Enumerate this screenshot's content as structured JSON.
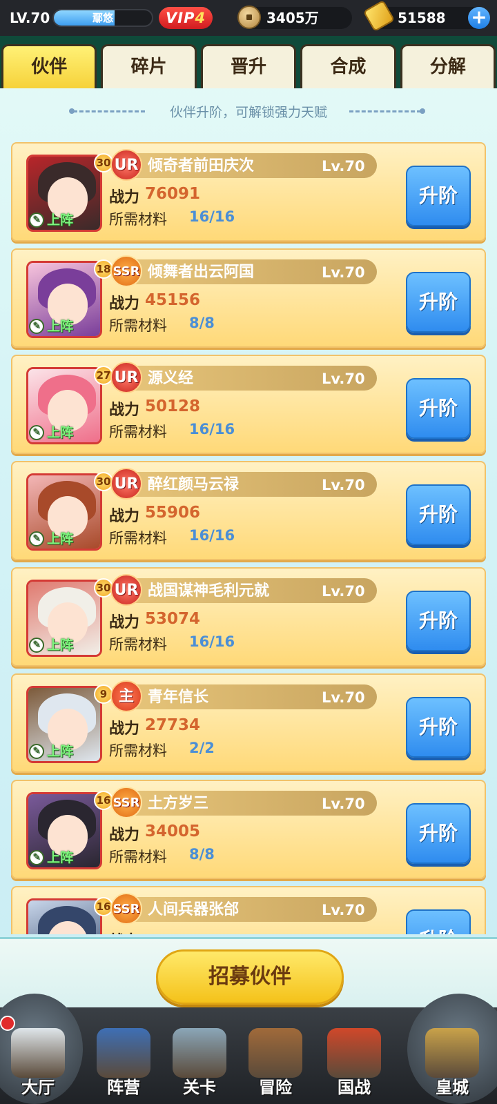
{
  "status": {
    "level": "LV.70",
    "player_name": "鄢悠",
    "exp_progress": 0.62,
    "vip_prefix": "VIP",
    "vip_level": "4",
    "coins": "3405万",
    "gold": "51588",
    "plus": "+"
  },
  "tabs": [
    {
      "label": "伙伴",
      "active": true
    },
    {
      "label": "碎片",
      "active": false
    },
    {
      "label": "晋升",
      "active": false
    },
    {
      "label": "合成",
      "active": false
    },
    {
      "label": "分解",
      "active": false
    }
  ],
  "hint": "伙伴升阶，可解锁强力天赋",
  "labels": {
    "power": "战力",
    "materials": "所需材料",
    "deploy": "上阵",
    "upgrade": "升阶"
  },
  "partners": [
    {
      "rarity": "UR",
      "name": "倾奇者前田庆次",
      "level": "Lv.70",
      "power": "76091",
      "materials": "16/16",
      "star": "30",
      "palette": [
        "#3a2a2a",
        "#b8262a"
      ]
    },
    {
      "rarity": "SSR",
      "name": "倾舞者出云阿国",
      "level": "Lv.70",
      "power": "45156",
      "materials": "8/8",
      "star": "18",
      "palette": [
        "#7a3e9a",
        "#f7c4dc"
      ]
    },
    {
      "rarity": "UR",
      "name": "源义经",
      "level": "Lv.70",
      "power": "50128",
      "materials": "16/16",
      "star": "27",
      "palette": [
        "#ef6f8a",
        "#fbe3e8"
      ]
    },
    {
      "rarity": "UR",
      "name": "醉红颜马云禄",
      "level": "Lv.70",
      "power": "55906",
      "materials": "16/16",
      "star": "30",
      "palette": [
        "#a84a2a",
        "#f3b6b6"
      ]
    },
    {
      "rarity": "UR",
      "name": "战国谋神毛利元就",
      "level": "Lv.70",
      "power": "53074",
      "materials": "16/16",
      "star": "30",
      "palette": [
        "#f1efe8",
        "#e07a70"
      ]
    },
    {
      "rarity": "主",
      "name": "青年信长",
      "level": "Lv.70",
      "power": "27734",
      "materials": "2/2",
      "star": "9",
      "palette": [
        "#dfe7ef",
        "#7c5a3a"
      ]
    },
    {
      "rarity": "SSR",
      "name": "土方岁三",
      "level": "Lv.70",
      "power": "34005",
      "materials": "8/8",
      "star": "16",
      "palette": [
        "#2a2630",
        "#7a5a9a"
      ]
    },
    {
      "rarity": "SSR",
      "name": "人间兵器张郃",
      "level": "Lv.70",
      "power": "",
      "materials": "",
      "star": "16",
      "palette": [
        "#34466a",
        "#c8d6ea"
      ]
    }
  ],
  "recruit_button": "招募伙伴",
  "nav": [
    {
      "label": "大厅",
      "icon": "hall-icon"
    },
    {
      "label": "阵营",
      "icon": "camp-icon"
    },
    {
      "label": "关卡",
      "icon": "stage-icon"
    },
    {
      "label": "冒险",
      "icon": "adventure-icon"
    },
    {
      "label": "国战",
      "icon": "national-war-icon"
    },
    {
      "label": "皇城",
      "icon": "imperial-city-icon"
    }
  ]
}
